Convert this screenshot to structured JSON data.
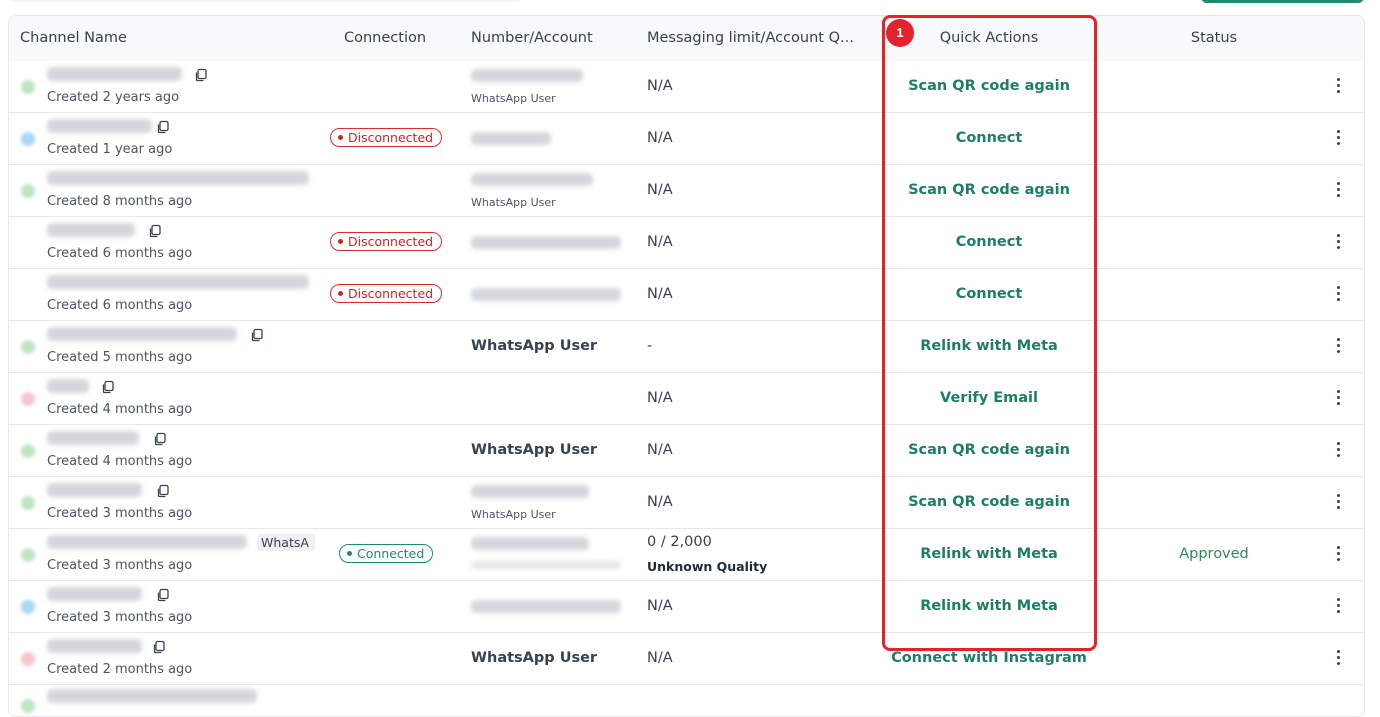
{
  "table": {
    "headers": {
      "channel_name": "Channel Name",
      "connection": "Connection",
      "number_account": "Number/Account",
      "messaging_limit": "Messaging limit/Account Q...",
      "quick_actions": "Quick Actions",
      "status": "Status"
    },
    "rows": [
      {
        "created": "Created 2 years ago",
        "connection": "",
        "number": "",
        "number_sub": "WhatsApp User",
        "limit": "N/A",
        "limit_sub": "",
        "action": "Scan QR code again",
        "status": "",
        "avatar": "#bfe6c2"
      },
      {
        "created": "Created 1 year ago",
        "connection": "Disconnected",
        "number": "",
        "number_sub": "",
        "limit": "N/A",
        "limit_sub": "",
        "action": "Connect",
        "status": "",
        "avatar": "#a9d7f7"
      },
      {
        "created": "Created 8 months ago",
        "connection": "",
        "number": "",
        "number_sub": "WhatsApp User",
        "limit": "N/A",
        "limit_sub": "",
        "action": "Scan QR code again",
        "status": "",
        "avatar": "#bfe6c2"
      },
      {
        "created": "Created 6 months ago",
        "connection": "Disconnected",
        "number": "",
        "number_sub": "",
        "limit": "N/A",
        "limit_sub": "",
        "action": "Connect",
        "status": "",
        "avatar": "#ffffff"
      },
      {
        "created": "Created 6 months ago",
        "connection": "Disconnected",
        "number": "",
        "number_sub": "",
        "limit": "N/A",
        "limit_sub": "",
        "action": "Connect",
        "status": "",
        "avatar": "#ffffff"
      },
      {
        "created": "Created 5 months ago",
        "connection": "",
        "number": "WhatsApp User",
        "number_sub": "",
        "limit": "-",
        "limit_sub": "",
        "action": "Relink with Meta",
        "status": "",
        "avatar": "#bfe6c2"
      },
      {
        "created": "Created 4 months ago",
        "connection": "",
        "number": "",
        "number_sub": "",
        "limit": "N/A",
        "limit_sub": "",
        "action": "Verify Email",
        "status": "",
        "avatar": "#f7c6cf"
      },
      {
        "created": "Created 4 months ago",
        "connection": "",
        "number": "WhatsApp User",
        "number_sub": "",
        "limit": "N/A",
        "limit_sub": "",
        "action": "Scan QR code again",
        "status": "",
        "avatar": "#bfe6c2"
      },
      {
        "created": "Created 3 months ago",
        "connection": "",
        "number": "",
        "number_sub": "WhatsApp User",
        "limit": "N/A",
        "limit_sub": "",
        "action": "Scan QR code again",
        "status": "",
        "avatar": "#bfe6c2"
      },
      {
        "created": "Created 3 months ago",
        "connection": "Connected",
        "number": "",
        "number_sub": "",
        "limit": "0 / 2,000",
        "limit_sub": "Unknown Quality",
        "action": "Relink with Meta",
        "status": "Approved",
        "avatar": "#bfe6c2",
        "tag": "WhatsA"
      },
      {
        "created": "Created 3 months ago",
        "connection": "",
        "number": "",
        "number_sub": "",
        "limit": "N/A",
        "limit_sub": "",
        "action": "Relink with Meta",
        "status": "",
        "avatar": "#a9d7f7"
      },
      {
        "created": "Created 2 months ago",
        "connection": "",
        "number": "WhatsApp User",
        "number_sub": "",
        "limit": "N/A",
        "limit_sub": "",
        "action": "Connect with Instagram",
        "status": "",
        "avatar": "#f7c6cf"
      }
    ]
  },
  "annotation": {
    "marker_label": "1",
    "color": "#e3232c"
  },
  "icons": {
    "copy": "copy-icon",
    "menu": "more-vertical-icon"
  },
  "colors": {
    "accent": "#1f7d66",
    "danger": "#c62828",
    "approved": "#2e8b57"
  }
}
